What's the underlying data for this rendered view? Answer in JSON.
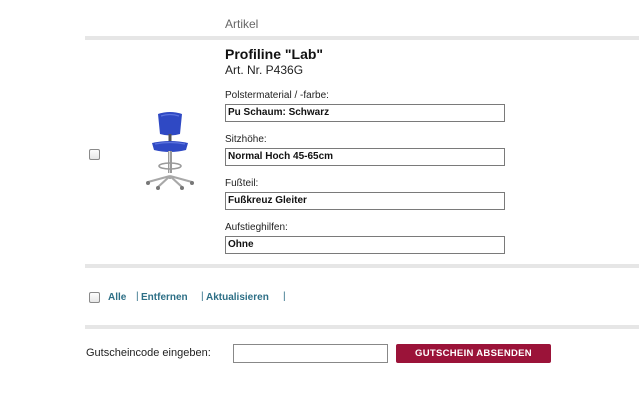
{
  "cart": {
    "column_header": "Artikel",
    "item": {
      "title": "Profiline \"Lab\"",
      "article_number": "Art. Nr. P436G",
      "image_icon": "office-chair-image",
      "options": [
        {
          "label": "Polstermaterial / -farbe:",
          "value": "Pu Schaum: Schwarz"
        },
        {
          "label": "Sitzhöhe:",
          "value": "Normal Hoch 45-65cm"
        },
        {
          "label": "Fußteil:",
          "value": "Fußkreuz Gleiter"
        },
        {
          "label": "Aufstieghilfen:",
          "value": "Ohne"
        }
      ]
    },
    "actions": {
      "all_label": "Alle",
      "remove_label": "Entfernen",
      "update_label": "Aktualisieren",
      "separator": "|"
    },
    "voucher": {
      "label": "Gutscheincode eingeben:",
      "input_value": "",
      "button_label": "GUTSCHEIN ABSENDEN"
    }
  },
  "colors": {
    "accent": "#9b1339",
    "link": "#2d6f86",
    "chair_blue": "#2f49c4",
    "divider": "#e6e6e6"
  }
}
